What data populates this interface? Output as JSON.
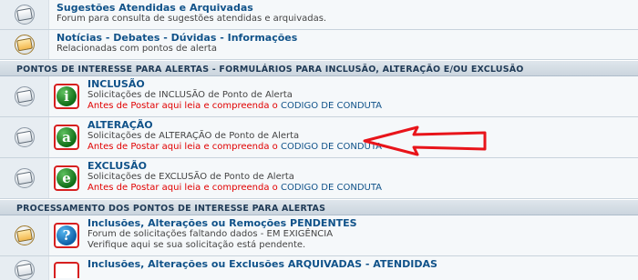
{
  "rows_top": [
    {
      "title": "Sugestões Atendidas e Arquivadas",
      "desc": "Forum para consulta de sugestões atendidas e arquivadas."
    },
    {
      "title": "Notícias - Debates - Dúvidas - Informações",
      "desc": "Relacionadas com pontos de alerta"
    }
  ],
  "category_1": "PONTOS DE INTERESSE PARA ALERTAS - FORMULÁRIOS PARA INCLUSÃO, ALTERAÇÃO E/OU EXCLUSÃO",
  "forms": [
    {
      "letter": "i",
      "title": "INCLUSÃO",
      "desc": "Solicitações de INCLUSÃO de Ponto de Alerta",
      "rule_red": "Antes de Postar aqui leia e compreenda o",
      "rule_link": "CODIGO DE CONDUTA"
    },
    {
      "letter": "a",
      "title": "ALTERAÇÃO",
      "desc": "Solicitações de ALTERAÇÃO de Ponto de Alerta",
      "rule_red": "Antes de Postar aqui leia e compreenda o",
      "rule_link": "CODIGO DE CONDUTA"
    },
    {
      "letter": "e",
      "title": "EXCLUSÃO",
      "desc": "Solicitações de EXCLUSÃO de Ponto de Alerta",
      "rule_red": "Antes de Postar aqui leia e compreenda o",
      "rule_link": "CODIGO DE CONDUTA"
    }
  ],
  "category_2": "PROCESSAMENTO DOS PONTOS DE INTERESSE PARA ALERTAS",
  "processing": [
    {
      "letter": "?",
      "title": "Inclusões, Alterações ou Remoções PENDENTES",
      "desc": "Forum de solicitações faltando dados - EM EXIGÊNCIA",
      "desc2": "Verifique aqui se sua solicitação está pendente."
    },
    {
      "title": "Inclusões, Alterações ou Exclusões ARQUIVADAS - ATENDIDAS"
    }
  ],
  "colors": {
    "link": "#105289",
    "alert_red": "#e10000",
    "arrow_red": "#e8141a",
    "category_bg": "#cbd5de"
  },
  "icons": {
    "read": "forum-read-icon",
    "unread": "forum-unread-icon"
  }
}
